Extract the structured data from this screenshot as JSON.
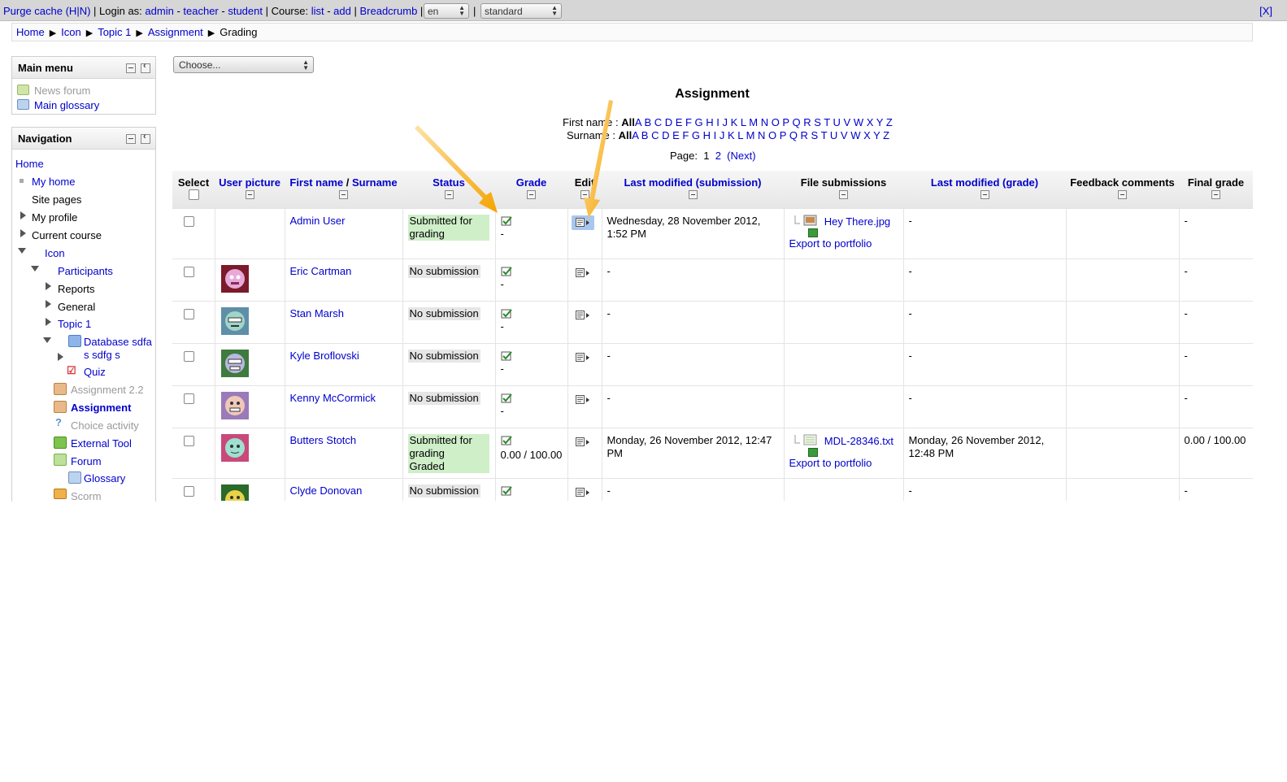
{
  "devbar": {
    "purge": "Purge cache (H|N)",
    "sep1": " | Login as: ",
    "login_admin": "admin",
    "dash1": " - ",
    "login_teacher": "teacher",
    "dash2": " - ",
    "login_student": "student",
    "sep2": " | Course: ",
    "course_list": "list",
    "dash3": " - ",
    "course_add": "add",
    "sep3": " | ",
    "breadcrumb": "Breadcrumb",
    "sep4": " |",
    "lang": "en",
    "sep5": "|",
    "theme": "standard",
    "close": "[X]"
  },
  "breadcrumb": [
    "Home",
    "Icon",
    "Topic 1",
    "Assignment",
    "Grading"
  ],
  "main_menu": {
    "title": "Main menu",
    "items": [
      "News forum",
      "Main glossary"
    ]
  },
  "navigation": {
    "title": "Navigation",
    "items": [
      "Home",
      "My home",
      "Site pages",
      "My profile",
      "Current course",
      "Icon",
      "Participants",
      "Reports",
      "General",
      "Topic 1",
      "Database sdfa",
      "s sdfg s",
      "Quiz",
      "Assignment 2.2",
      "Assignment",
      "Choice activity",
      "External Tool",
      "Forum",
      "Glossary",
      "Scorm"
    ]
  },
  "choose": "Choose...",
  "page_title": "Assignment",
  "filters": {
    "firstname_label": "First name : ",
    "surname_label": "Surname : ",
    "all": "All",
    "letters": "A B C D E F G H I J K L M N O P Q R S T U V W X Y Z"
  },
  "paging": {
    "label": "Page:",
    "p1": "1",
    "p2": "2",
    "next": "(Next)"
  },
  "table": {
    "headers": {
      "select": "Select",
      "picture": "User picture",
      "firstname": "First name",
      "slash": " / ",
      "surname": "Surname",
      "status": "Status",
      "grade": "Grade",
      "edit": "Edit",
      "lastmod_sub": "Last modified (submission)",
      "files": "File submissions",
      "lastmod_grade": "Last modified (grade)",
      "feedback": "Feedback comments",
      "final": "Final grade"
    },
    "rows": [
      {
        "name": "Admin User",
        "status1": "Submitted for",
        "status2": "grading",
        "status3": "",
        "grade": "-",
        "modified": "Wednesday, 28 November 2012, 1:52 PM",
        "file": "Hey There.jpg",
        "export": "Export to portfolio",
        "gmod": "-",
        "final": "-"
      },
      {
        "name": "Eric Cartman",
        "status1": "No submission",
        "grade": "-",
        "modified": "-",
        "gmod": "-",
        "final": "-"
      },
      {
        "name": "Stan Marsh",
        "status1": "No submission",
        "grade": "-",
        "modified": "-",
        "gmod": "-",
        "final": "-"
      },
      {
        "name": "Kyle Broflovski",
        "status1": "No submission",
        "grade": "-",
        "modified": "-",
        "gmod": "-",
        "final": "-"
      },
      {
        "name": "Kenny McCormick",
        "status1": "No submission",
        "grade": "-",
        "modified": "-",
        "gmod": "-",
        "final": "-"
      },
      {
        "name": "Butters Stotch",
        "status1": "Submitted for",
        "status2": "grading",
        "status3": "Graded",
        "grade": "0.00 / 100.00",
        "modified": "Monday, 26 November 2012, 12:47 PM",
        "file": "MDL-28346.txt",
        "export": "Export to portfolio",
        "gmod": "Monday, 26 November 2012, 12:48 PM",
        "final": "0.00 / 100.00"
      },
      {
        "name": "Clyde Donovan",
        "status1": "No submission",
        "grade": "",
        "modified": "-",
        "gmod": "-",
        "final": "-"
      }
    ]
  },
  "colors": {
    "link": "#0000cc",
    "submitted": "#cfefc9",
    "arrow": "#f5a623",
    "edit_highlight": "#a9c7ee"
  }
}
